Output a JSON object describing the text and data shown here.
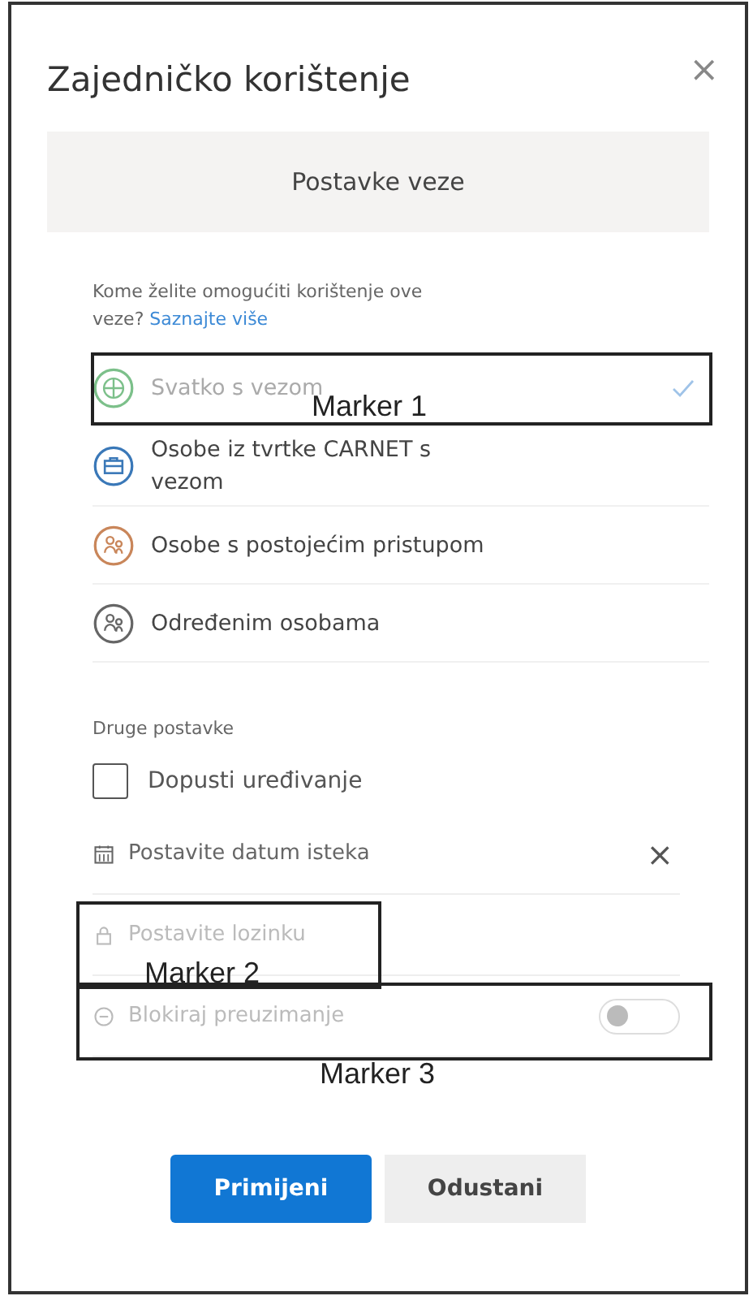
{
  "dialog": {
    "title": "Zajedničko korištenje",
    "close": "×"
  },
  "banner": {
    "label": "Postavke veze"
  },
  "question": {
    "text": "Kome želite omogućiti korištenje ove veze?",
    "link": "Saznajte više"
  },
  "options": [
    {
      "kind": "globe",
      "label": "Svatko s vezom",
      "color": "#7cc08a",
      "selected": true,
      "marker": "Marker 1"
    },
    {
      "kind": "company",
      "label": "Osobe iz tvrtke CARNET s vezom",
      "color": "#3a78b8",
      "selected": false
    },
    {
      "kind": "existing",
      "label": "Osobe s postojećim pristupom",
      "color": "#c9865a",
      "selected": false
    },
    {
      "kind": "specific",
      "label": "Određenim osobama",
      "color": "#666666",
      "selected": false
    }
  ],
  "other_settings": {
    "heading": "Druge postavke",
    "items": [
      {
        "kind": "checkbox",
        "label": "Dopusti uređivanje",
        "checked": false,
        "disabled": false
      },
      {
        "kind": "date",
        "placeholder": "Postavite datum isteka",
        "clear": "×",
        "disabled": false
      },
      {
        "kind": "password",
        "placeholder": "Postavite lozinku",
        "disabled": true,
        "marker": "Marker 2"
      },
      {
        "kind": "toggle",
        "label": "Blokiraj preuzimanje",
        "on": false,
        "disabled": true,
        "marker": "Marker 3"
      }
    ]
  },
  "buttons": [
    {
      "kind": "primary",
      "label": "Primijeni"
    },
    {
      "kind": "secondary",
      "label": "Odustani"
    }
  ]
}
